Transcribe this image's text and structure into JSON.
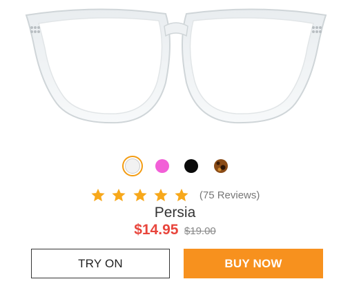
{
  "product": {
    "name": "Persia",
    "price": "$14.95",
    "original_price": "$19.00",
    "rating": 5,
    "reviews_text": "(75 Reviews)"
  },
  "swatches": [
    {
      "color": "#f2f2f2",
      "selected": true,
      "name": "clear"
    },
    {
      "color": "#f25fd7",
      "selected": false,
      "name": "pink"
    },
    {
      "color": "#0a0a0a",
      "selected": false,
      "name": "black"
    },
    {
      "color": "#8a4b16",
      "selected": false,
      "name": "tortoise"
    }
  ],
  "colors": {
    "accent": "#f7911e",
    "price_red": "#e8453c",
    "star": "#f7a81b"
  },
  "buttons": {
    "try_on": "TRY ON",
    "buy_now": "BUY NOW"
  }
}
